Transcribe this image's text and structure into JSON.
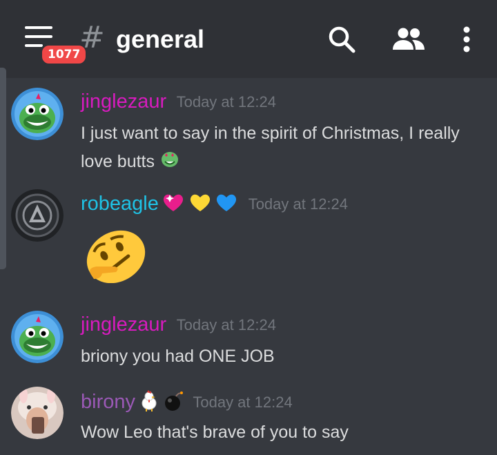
{
  "header": {
    "channel_hash": "#",
    "channel_name": "general",
    "notification_badge": "1077"
  },
  "messages": [
    {
      "username": "jinglezaur",
      "username_color": "#d81bbf",
      "timestamp": "Today at 12:24",
      "text": "I just want to say in the spirit of Christmas, I really love butts",
      "avatar": "green-dinosaur-avatar"
    },
    {
      "username": "robeagle",
      "username_color": "#1fc3e6",
      "timestamp": "Today at 12:24",
      "text": "",
      "avatar": "dark-emblem-avatar",
      "badges": [
        "sparkling-heart-icon",
        "yellow-heart-icon",
        "blue-heart-icon"
      ],
      "attachment": "thinking-face-sideways-emoji"
    },
    {
      "username": "jinglezaur",
      "username_color": "#d81bbf",
      "timestamp": "Today at 12:24",
      "text": "briony you had ONE JOB",
      "avatar": "green-dinosaur-avatar"
    },
    {
      "username": "birony",
      "username_color": "#9b59b6",
      "timestamp": "Today at 12:24",
      "text": "Wow Leo that's brave of you to say",
      "avatar": "girl-in-bunny-hat-avatar",
      "badges": [
        "rooster-icon",
        "bomb-icon"
      ]
    }
  ],
  "colors": {
    "background": "#36393f",
    "header_background": "#2f3136",
    "badge": "#f04747",
    "message_text": "#dcddde",
    "timestamp": "#72767d"
  }
}
